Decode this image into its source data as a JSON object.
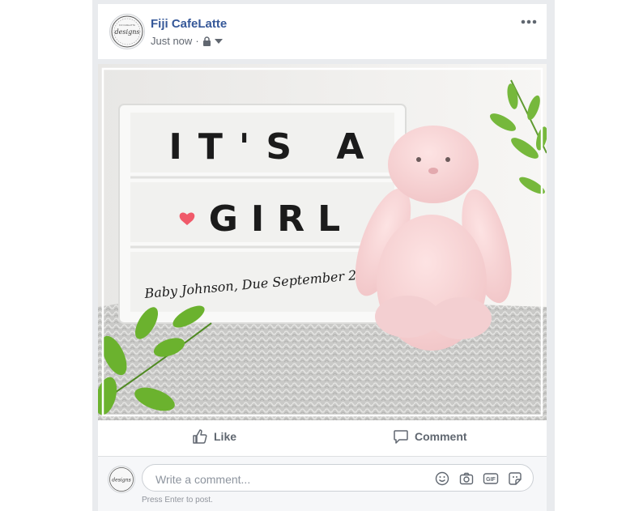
{
  "post": {
    "author": "Fiji CafeLatte",
    "timestamp": "Just now",
    "separator": "·",
    "privacy_icon": "lock-icon",
    "audience_icon": "caret-down-icon",
    "more_icon": "more-dots-icon"
  },
  "avatar": {
    "logo_text": "designs",
    "logo_small": "FIJI CAFELATTE"
  },
  "image": {
    "lightbox_line1": "IT'S A",
    "lightbox_line2": "GIRL",
    "caption": "Baby Johnson, Due September 2019",
    "heart_color": "#f05a6a"
  },
  "actions": {
    "like_label": "Like",
    "comment_label": "Comment"
  },
  "comment": {
    "placeholder": "Write a comment...",
    "hint": "Press Enter to post.",
    "icons": [
      "emoji-icon",
      "camera-icon",
      "gif-icon",
      "sticker-icon"
    ]
  },
  "colors": {
    "author": "#365899",
    "frame": "#e9ebee"
  }
}
